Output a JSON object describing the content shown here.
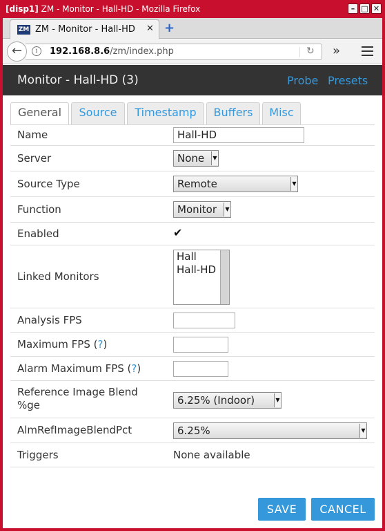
{
  "window": {
    "title_prefix": "[disp1]",
    "title": "ZM - Monitor - Hall-HD - Mozilla Firefox",
    "controls": {
      "minimize": "–",
      "maximize": "□",
      "close": "✕"
    }
  },
  "browser": {
    "tab": {
      "favicon": "ZM",
      "title": "ZM - Monitor - Hall-HD",
      "close": "✕"
    },
    "new_tab": "+",
    "url_host": "192.168.8.6",
    "url_path": "/zm/index.php",
    "icons": {
      "back": "back-arrow-icon",
      "info": "info-icon",
      "reload": "reload-icon",
      "overflow": "chevron-double-right-icon",
      "menu": "hamburger-menu-icon"
    }
  },
  "header": {
    "title": "Monitor - Hall-HD (3)",
    "links": [
      "Probe",
      "Presets"
    ]
  },
  "tabs": [
    {
      "label": "General",
      "active": true
    },
    {
      "label": "Source",
      "active": false
    },
    {
      "label": "Timestamp",
      "active": false
    },
    {
      "label": "Buffers",
      "active": false
    },
    {
      "label": "Misc",
      "active": false
    }
  ],
  "form": {
    "name": {
      "label": "Name",
      "value": "Hall-HD"
    },
    "server": {
      "label": "Server",
      "value": "None"
    },
    "source_type": {
      "label": "Source Type",
      "value": "Remote"
    },
    "function": {
      "label": "Function",
      "value": "Monitor"
    },
    "enabled": {
      "label": "Enabled",
      "checked": true
    },
    "linked_monitors": {
      "label": "Linked Monitors",
      "options": [
        "Hall",
        "Hall-HD"
      ]
    },
    "analysis_fps": {
      "label": "Analysis FPS",
      "value": ""
    },
    "maximum_fps": {
      "label": "Maximum FPS (",
      "help": "?",
      "suffix": ")",
      "value": ""
    },
    "alarm_maximum_fps": {
      "label": "Alarm Maximum FPS (",
      "help": "?",
      "suffix": ")",
      "value": ""
    },
    "ref_blend": {
      "label_line1": "Reference Image Blend",
      "label_line2": "%ge",
      "value": "6.25% (Indoor)"
    },
    "alm_ref_blend": {
      "label": "AlmRefImageBlendPct",
      "value": "6.25%"
    },
    "triggers": {
      "label": "Triggers",
      "value": "None available"
    }
  },
  "buttons": {
    "save": "SAVE",
    "cancel": "CANCEL"
  },
  "colors": {
    "window_frame": "#c8102e",
    "header_bg": "#333333",
    "accent": "#3498db"
  }
}
